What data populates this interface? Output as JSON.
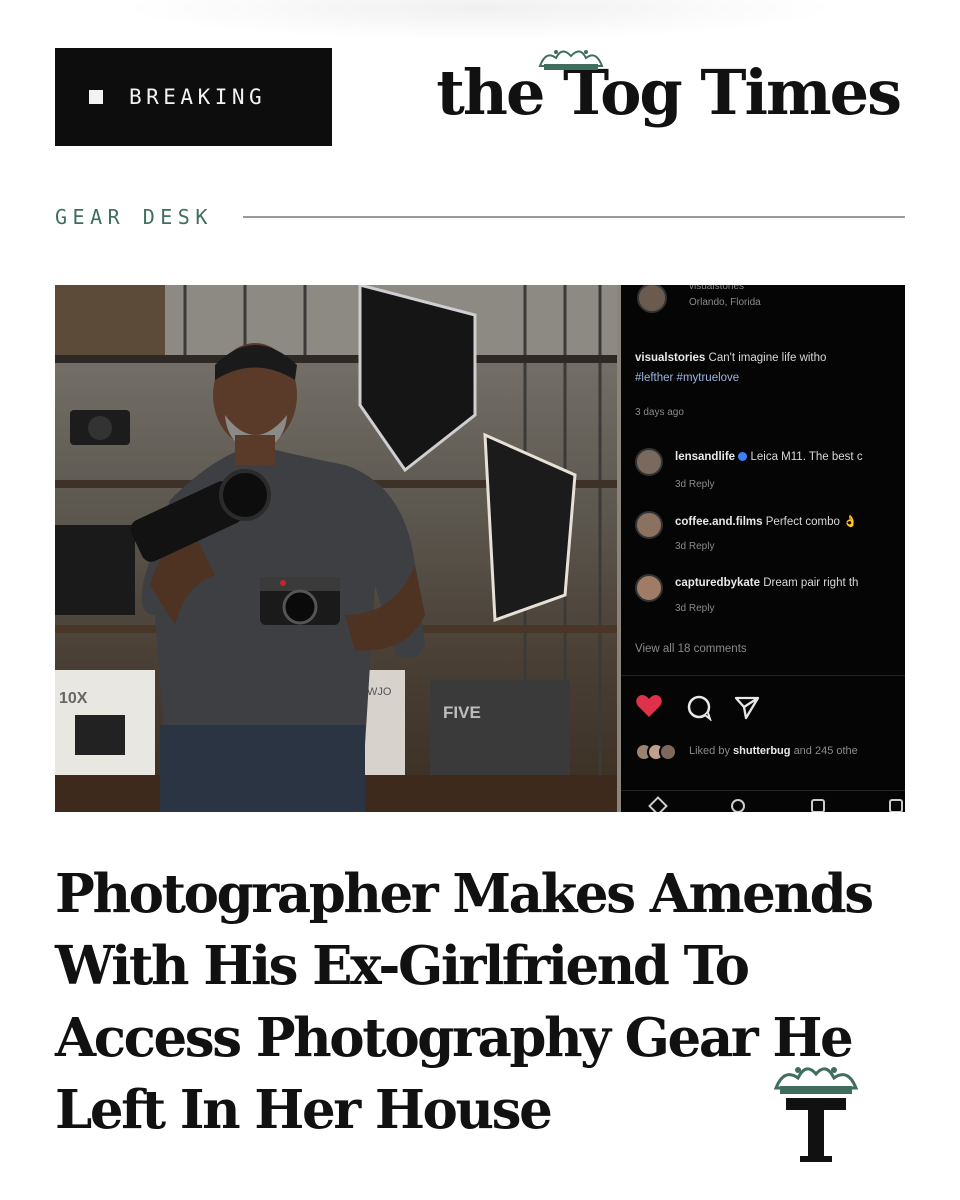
{
  "breaking": {
    "label": "BREAKING"
  },
  "masthead": {
    "name": "the Tog Times"
  },
  "section": {
    "label": "GEAR DESK"
  },
  "hero": {
    "photo": {
      "box_labels": [
        "10X",
        "FIVE",
        "WJO"
      ]
    },
    "instagram": {
      "header_user": "visualstories",
      "header_location": "Orlando, Florida",
      "caption_user": "visualstories",
      "caption_text": "Can't imagine life witho",
      "caption_tags": "#lefther #mytruelove",
      "posted": "3 days ago",
      "comments": [
        {
          "user": "lensandlife",
          "text": "Leica M11. The best c",
          "meta": "3d  Reply"
        },
        {
          "user": "coffee.and.films",
          "text": "Perfect combo 👌",
          "meta": "3d  Reply"
        },
        {
          "user": "capturedbykate",
          "text": "Dream pair right th",
          "meta": "3d  Reply"
        }
      ],
      "view_all": "View all 18 comments",
      "liked_prefix": "Liked by",
      "liked_user": "shutterbug",
      "liked_suffix": "and 245 othe"
    }
  },
  "headline": "Photographer Makes Amends With His Ex-Girlfriend To Access Photography Gear He Left In Her House",
  "colors": {
    "accent_green": "#3f6f5c",
    "badge_bg": "#0d0d0d",
    "heart_red": "#e0314b"
  },
  "icons": [
    "crown-icon",
    "heart-icon",
    "comment-icon",
    "share-icon",
    "verified-icon",
    "tog-times-logo"
  ]
}
